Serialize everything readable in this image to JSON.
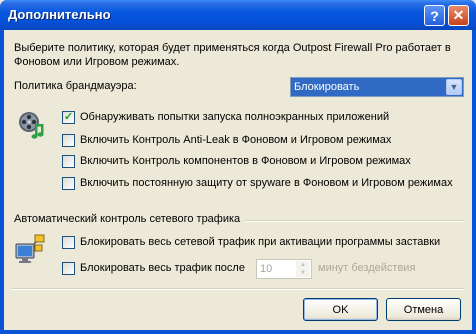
{
  "window": {
    "title": "Дополнительно",
    "help_label": "?",
    "close_label": "✕"
  },
  "description": "Выберите политику, которая будет применяться когда Outpost Firewall Pro работает в Фоновом или Игровом режимах.",
  "policy": {
    "label": "Политика брандмауэра:",
    "value": "Блокировать",
    "arrow": "▼"
  },
  "options": [
    {
      "label": "Обнаруживать попытки запуска полноэкранных приложений",
      "checked": true
    },
    {
      "label": "Включить Контроль Anti-Leak в Фоновом и Игровом режимах",
      "checked": false
    },
    {
      "label": "Включить Контроль компонентов в Фоновом и Игровом режимах",
      "checked": false
    },
    {
      "label": "Включить постоянную защиту от spyware в Фоновом и Игровом режимах",
      "checked": false
    }
  ],
  "traffic": {
    "group_label": "Автоматический контроль сетевого трафика",
    "block_screensaver": {
      "label": "Блокировать весь сетевой трафик при активации программы заставки",
      "checked": false
    },
    "block_after": {
      "label": "Блокировать весь трафик после",
      "checked": false
    },
    "minutes_value": "10",
    "minutes_suffix": "минут бездействия"
  },
  "buttons": {
    "ok": "OK",
    "cancel": "Отмена"
  },
  "check_mark": "✓",
  "icons": {
    "fullscreen": "film-reel-music-icon",
    "network": "network-monitor-icon"
  },
  "colors": {
    "titlebar": "#0858e0",
    "dialog_bg": "#ece9d8",
    "select_highlight": "#316ac5"
  }
}
